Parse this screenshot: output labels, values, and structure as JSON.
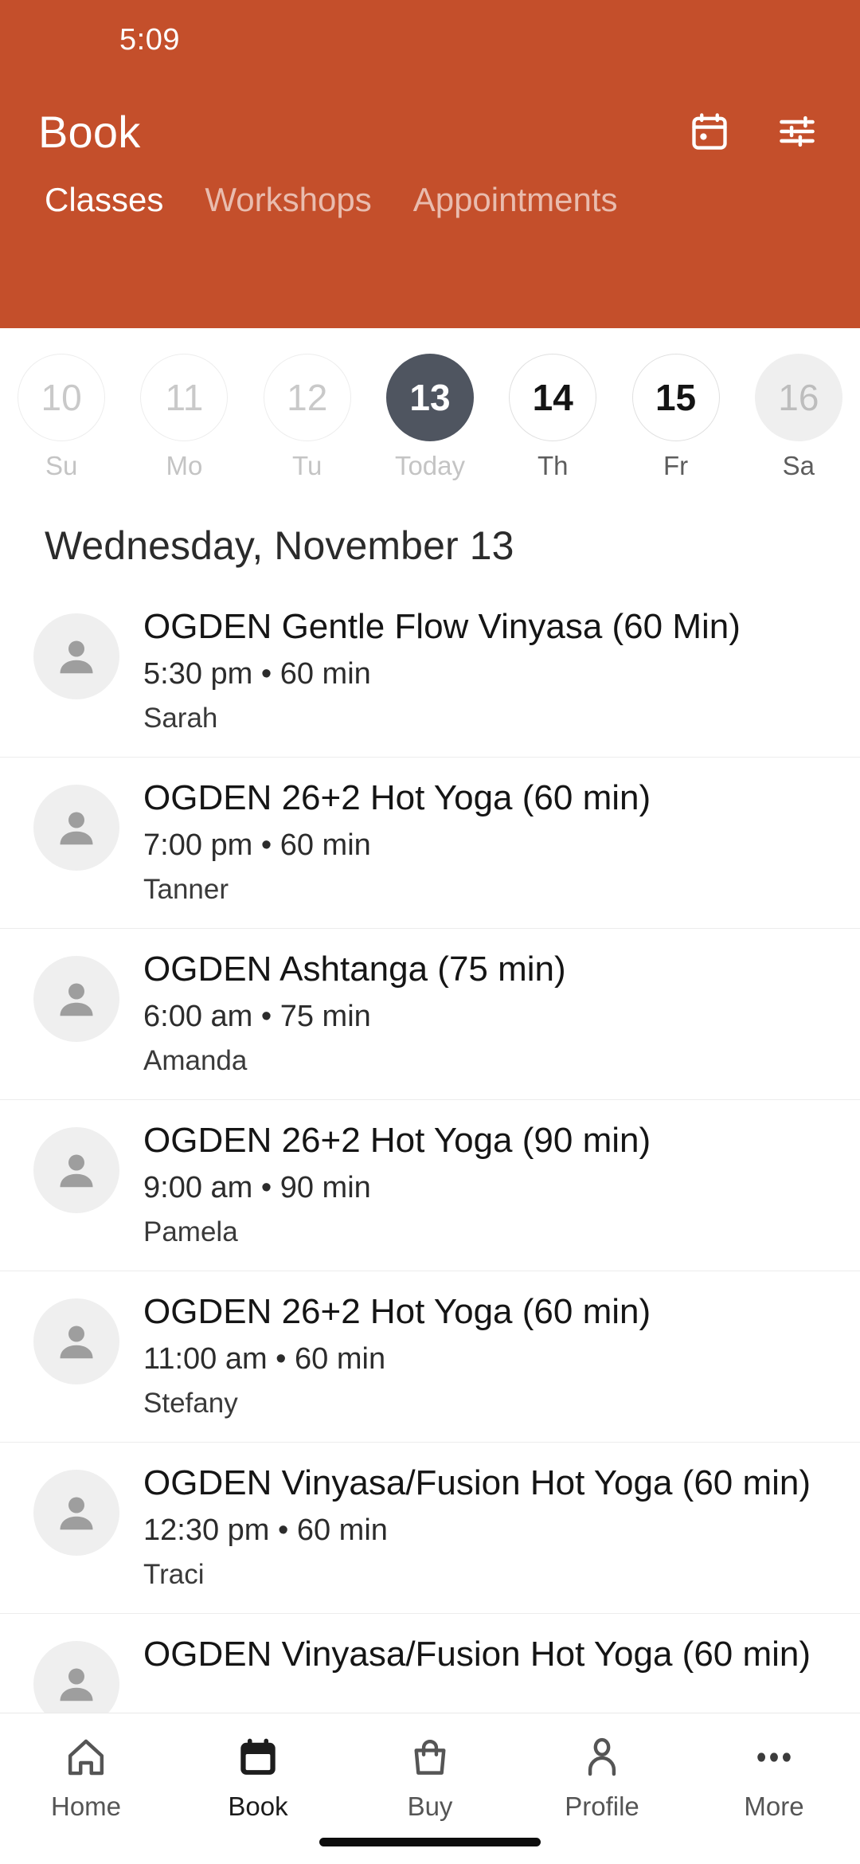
{
  "status_bar": {
    "time": "5:09"
  },
  "header": {
    "title": "Book",
    "accent_color": "#c44f2b",
    "actions": [
      {
        "name": "calendar-icon",
        "label": "calendar-icon"
      },
      {
        "name": "filter-icon",
        "label": "filter-sliders-icon"
      }
    ]
  },
  "tabs": [
    {
      "label": "Classes",
      "active": true
    },
    {
      "label": "Workshops",
      "active": false
    },
    {
      "label": "Appointments",
      "active": false
    }
  ],
  "date_strip": {
    "selected_color": "#4f5560",
    "days": [
      {
        "num": "10",
        "weekday": "Su",
        "state": "disabled"
      },
      {
        "num": "11",
        "weekday": "Mo",
        "state": "disabled"
      },
      {
        "num": "12",
        "weekday": "Tu",
        "state": "disabled"
      },
      {
        "num": "13",
        "weekday": "Today",
        "state": "selected"
      },
      {
        "num": "14",
        "weekday": "Th",
        "state": "enabled"
      },
      {
        "num": "15",
        "weekday": "Fr",
        "state": "enabled"
      },
      {
        "num": "16",
        "weekday": "Sa",
        "state": "filled"
      }
    ]
  },
  "date_heading": "Wednesday, November 13",
  "classes": [
    {
      "title": "OGDEN Gentle Flow Vinyasa (60 Min)",
      "meta": "5:30 pm • 60 min",
      "teacher": "Sarah"
    },
    {
      "title": "OGDEN 26+2 Hot Yoga (60 min)",
      "meta": "7:00 pm • 60 min",
      "teacher": "Tanner"
    },
    {
      "title": "OGDEN Ashtanga (75 min)",
      "meta": "6:00 am • 75 min",
      "teacher": "Amanda"
    },
    {
      "title": "OGDEN 26+2 Hot Yoga (90 min)",
      "meta": "9:00 am • 90 min",
      "teacher": "Pamela"
    },
    {
      "title": "OGDEN 26+2 Hot Yoga (60 min)",
      "meta": "11:00 am • 60 min",
      "teacher": "Stefany"
    },
    {
      "title": "OGDEN Vinyasa/Fusion Hot Yoga (60 min)",
      "meta": "12:30 pm • 60 min",
      "teacher": "Traci"
    },
    {
      "title": "OGDEN Vinyasa/Fusion Hot Yoga (60 min)",
      "meta": "",
      "teacher": ""
    }
  ],
  "bottom_nav": [
    {
      "label": "Home",
      "icon": "home-icon",
      "active": false
    },
    {
      "label": "Book",
      "icon": "calendar-icon",
      "active": true
    },
    {
      "label": "Buy",
      "icon": "shopping-bag-icon",
      "active": false
    },
    {
      "label": "Profile",
      "icon": "person-icon",
      "active": false
    },
    {
      "label": "More",
      "icon": "ellipsis-icon",
      "active": false
    }
  ]
}
